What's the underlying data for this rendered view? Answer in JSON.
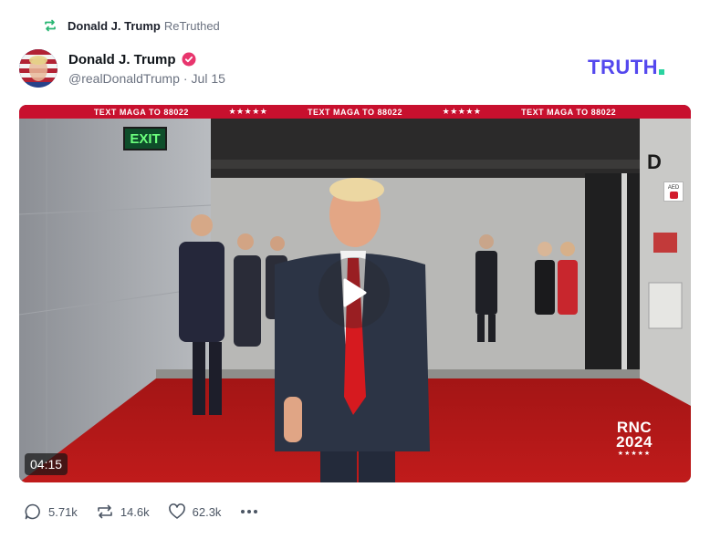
{
  "retruth": {
    "user_name": "Donald J. Trump",
    "action": "ReTruthed",
    "icon": "retruth-icon",
    "icon_color": "#2ab673"
  },
  "post": {
    "author_name": "Donald J. Trump",
    "verified_icon": "verified-badge-icon",
    "verified_color": "#e8356d",
    "handle": "@realDonaldTrump",
    "separator": "·",
    "date": "Jul 15"
  },
  "brand": {
    "logo_text": "TRUTH",
    "logo_color": "#5448ee",
    "dot_color": "#2ad3a0"
  },
  "video": {
    "banner_segments": [
      "TEXT MAGA TO 88022",
      "★★★★★",
      "TEXT MAGA TO 88022",
      "★★★★★",
      "TEXT MAGA TO 88022"
    ],
    "exit_sign": "EXIT",
    "door_letter": "D",
    "aed_label": "AED",
    "badge_line1": "RNC",
    "badge_line2": "2024",
    "badge_stars": "★★★★★",
    "duration": "04:15",
    "play_icon": "play-icon"
  },
  "actions": {
    "replies": {
      "icon": "reply-icon",
      "count": "5.71k"
    },
    "retruths": {
      "icon": "retruth-icon",
      "count": "14.6k"
    },
    "likes": {
      "icon": "heart-icon",
      "count": "62.3k"
    },
    "more": {
      "icon": "more-icon"
    }
  }
}
